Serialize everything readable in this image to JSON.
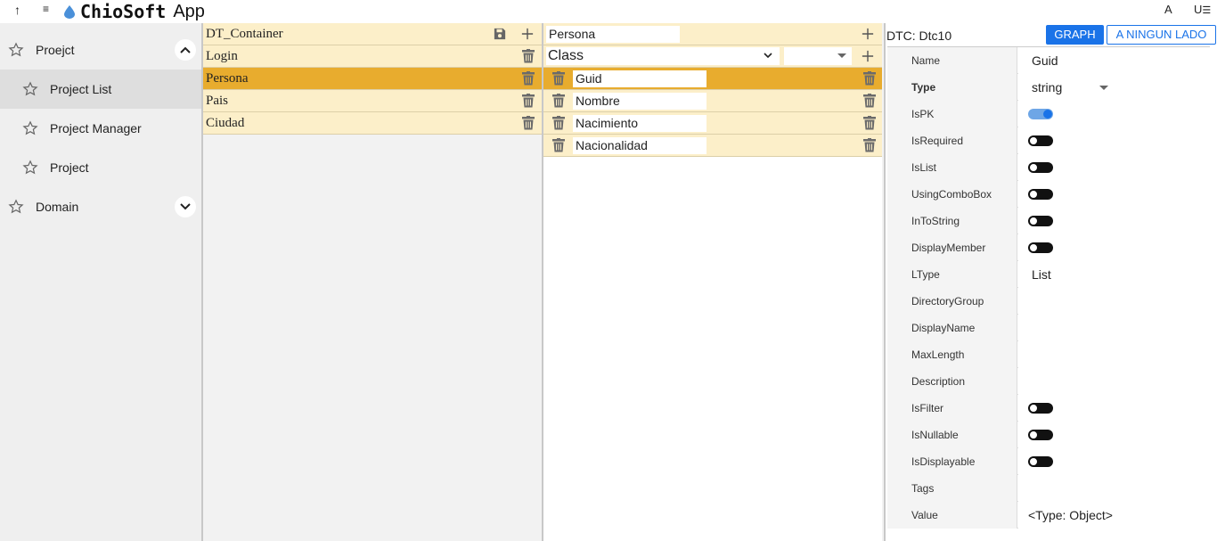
{
  "topbar": {
    "up_icon": "arrow-up-icon",
    "menu_icon": "hamburger-icon",
    "brand_name": "ChioSoft",
    "brand_suffix": "App",
    "font_btn": "A",
    "user_btn": "U"
  },
  "sidebar": {
    "items": [
      {
        "label": "Proejct",
        "icon": "star-icon",
        "chevron": "up"
      },
      {
        "label": "Project List",
        "icon": "star-icon"
      },
      {
        "label": "Project Manager",
        "icon": "star-icon"
      },
      {
        "label": "Project",
        "icon": "star-icon"
      },
      {
        "label": "Domain",
        "icon": "star-icon",
        "chevron": "down"
      }
    ]
  },
  "containers": {
    "header": "DT_Container",
    "items": [
      "Login",
      "Persona",
      "Pais",
      "Ciudad"
    ],
    "selected": "Persona"
  },
  "members": {
    "name_value": "Persona",
    "kind_value": "Class",
    "fields": [
      "Guid",
      "Nombre",
      "Nacimiento",
      "Nacionalidad"
    ],
    "selected": "Guid"
  },
  "props": {
    "title": "DTC: Dtc10",
    "graph_btn": "GRAPH",
    "side_btn": "A NINGUN LADO",
    "rows": [
      {
        "key": "Name",
        "value": "Guid"
      },
      {
        "key": "Type",
        "value": "string"
      },
      {
        "key": "IsPK",
        "toggle": true
      },
      {
        "key": "IsRequired",
        "toggle": false
      },
      {
        "key": "IsList",
        "toggle": false
      },
      {
        "key": "UsingComboBox",
        "toggle": false
      },
      {
        "key": "InToString",
        "toggle": false
      },
      {
        "key": "DisplayMember",
        "toggle": false
      },
      {
        "key": "LType",
        "value": "List"
      },
      {
        "key": "DirectoryGroup",
        "value": ""
      },
      {
        "key": "DisplayName",
        "value": ""
      },
      {
        "key": "MaxLength",
        "value": ""
      },
      {
        "key": "Description",
        "value": ""
      },
      {
        "key": "IsFilter",
        "toggle": false
      },
      {
        "key": "IsNullable",
        "toggle": false
      },
      {
        "key": "IsDisplayable",
        "toggle": false
      },
      {
        "key": "Tags",
        "value": ""
      },
      {
        "key": "Value",
        "value": "<Type: Object>"
      }
    ]
  },
  "colors": {
    "row_bg": "#fcefc9",
    "selected_bg": "#e8ac2e",
    "accent": "#1a73e8"
  }
}
